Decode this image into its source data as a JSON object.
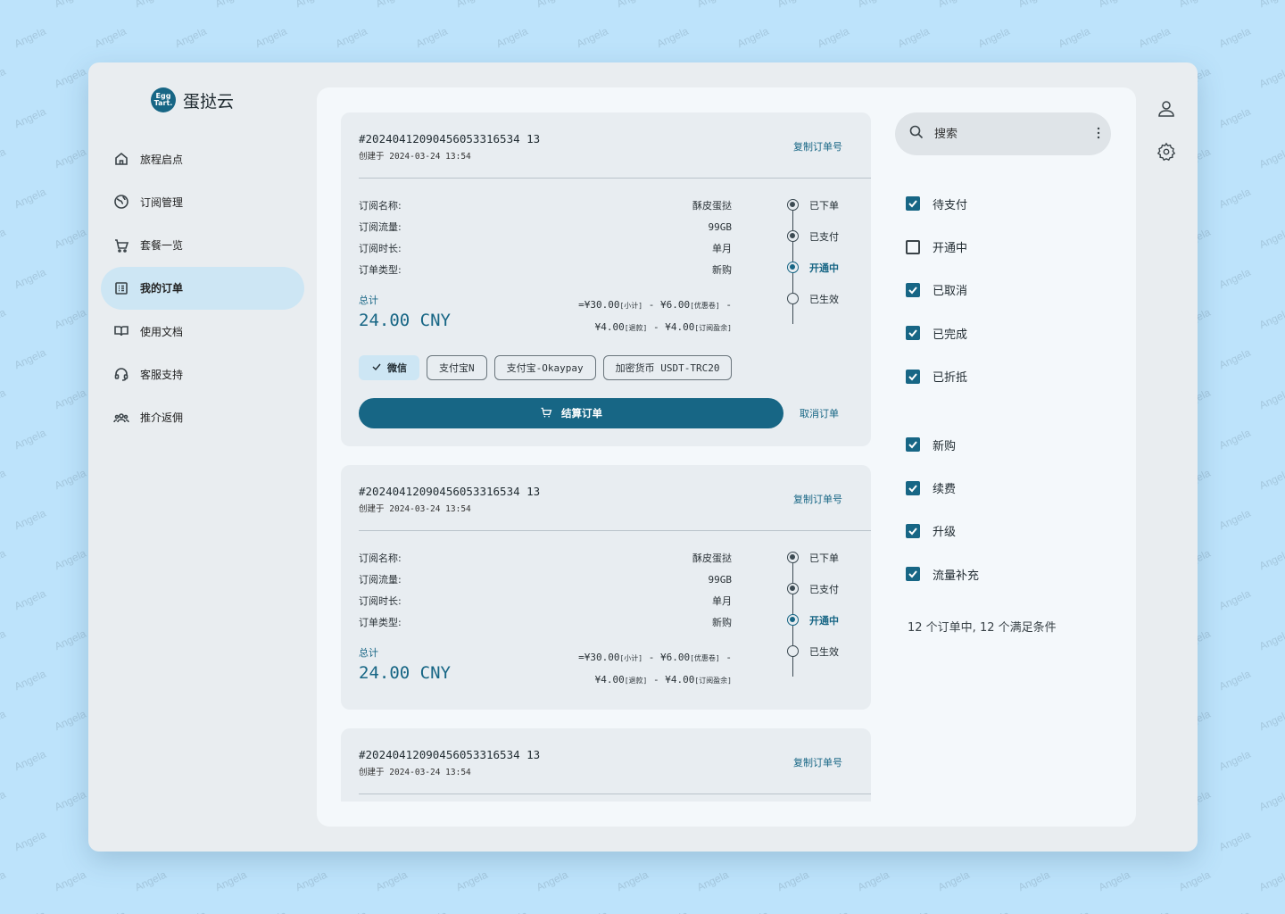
{
  "watermark": "Angela",
  "brand": {
    "logo_line1": "Egg",
    "logo_line2": "Tart.",
    "name": "蛋挞云"
  },
  "nav": [
    {
      "label": "旅程启点",
      "icon": "home-icon"
    },
    {
      "label": "订阅管理",
      "icon": "globe-icon"
    },
    {
      "label": "套餐一览",
      "icon": "cart-icon"
    },
    {
      "label": "我的订单",
      "icon": "list-icon",
      "active": true
    },
    {
      "label": "使用文档",
      "icon": "book-icon"
    },
    {
      "label": "客服支持",
      "icon": "headset-icon"
    },
    {
      "label": "推介返佣",
      "icon": "group-icon"
    }
  ],
  "labels": {
    "copy": "复制订单号",
    "created_prefix": "创建于",
    "sub_name": "订阅名称:",
    "sub_traffic": "订阅流量:",
    "sub_duration": "订阅时长:",
    "order_type": "订单类型:",
    "total": "总计",
    "checkout": "结算订单",
    "cancel": "取消订单"
  },
  "orders": [
    {
      "id": "#20240412090456053316534 13",
      "created": "2024-03-24 13:54",
      "name": "酥皮蛋挞",
      "traffic": "99GB",
      "duration": "单月",
      "type": "新购",
      "amount": "24.00 CNY",
      "breakdown_line1": "=¥30.00",
      "breakdown_tag1": "[小计]",
      "breakdown_op1": " - ¥6.00",
      "breakdown_tag2": "[优惠卷]",
      "breakdown_op2": " -",
      "breakdown_line2": "¥4.00",
      "breakdown_tag3": "[退款]",
      "breakdown_op3": " - ¥4.00",
      "breakdown_tag4": "[订阅盈余]",
      "steps": [
        "已下单",
        "已支付",
        "开通中",
        "已生效"
      ],
      "current_step": 2,
      "payments": [
        "微信",
        "支付宝N",
        "支付宝-Okaypay",
        "加密货币 USDT-TRC20"
      ],
      "selected_payment": 0,
      "show_actions": true
    },
    {
      "id": "#20240412090456053316534 13",
      "created": "2024-03-24 13:54",
      "name": "酥皮蛋挞",
      "traffic": "99GB",
      "duration": "单月",
      "type": "新购",
      "amount": "24.00 CNY",
      "breakdown_line1": "=¥30.00",
      "breakdown_tag1": "[小计]",
      "breakdown_op1": " - ¥6.00",
      "breakdown_tag2": "[优惠卷]",
      "breakdown_op2": " -",
      "breakdown_line2": "¥4.00",
      "breakdown_tag3": "[退款]",
      "breakdown_op3": " - ¥4.00",
      "breakdown_tag4": "[订阅盈余]",
      "steps": [
        "已下单",
        "已支付",
        "开通中",
        "已生效"
      ],
      "current_step": 2,
      "show_actions": false
    },
    {
      "id": "#20240412090456053316534 13",
      "created": "2024-03-24 13:54"
    }
  ],
  "search": {
    "placeholder": "搜索"
  },
  "filters_status": [
    {
      "label": "待支付",
      "checked": true
    },
    {
      "label": "开通中",
      "checked": false
    },
    {
      "label": "已取消",
      "checked": true
    },
    {
      "label": "已完成",
      "checked": true
    },
    {
      "label": "已折抵",
      "checked": true
    }
  ],
  "filters_type": [
    {
      "label": "新购",
      "checked": true
    },
    {
      "label": "续费",
      "checked": true
    },
    {
      "label": "升级",
      "checked": true
    },
    {
      "label": "流量补充",
      "checked": true
    }
  ],
  "summary": "12 个订单中, 12 个满足条件",
  "colors": {
    "accent": "#176685",
    "chip_selected": "#cde6f4",
    "background": "#bde3fb"
  }
}
